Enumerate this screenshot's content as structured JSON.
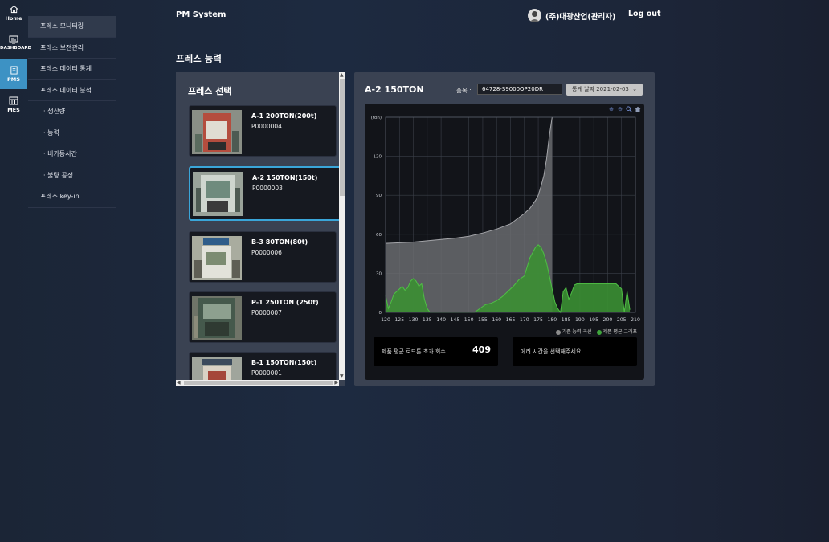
{
  "rail": {
    "home": "Home",
    "dashboard": "DASHBOARD",
    "pms": "PMS",
    "mes": "MES"
  },
  "sidebar": {
    "items": [
      {
        "label": "프레스 모니터링"
      },
      {
        "label": "프레스 보전관리"
      },
      {
        "label": "프레스 데이터 통계"
      },
      {
        "label": "프레스 데이터 분석"
      },
      {
        "label": "· 생산량"
      },
      {
        "label": "· 능력"
      },
      {
        "label": "· 비가동시간"
      },
      {
        "label": "· 불량 공정"
      },
      {
        "label": "프레스 key-in"
      }
    ]
  },
  "header": {
    "app_title": "PM System",
    "user": "(주)대광산업(관리자)",
    "logout": "Log out"
  },
  "page_title": "프레스 능력",
  "press_panel": {
    "title": "프레스 선택",
    "presses": [
      {
        "name": "A-1 200TON(200t)",
        "code": "P0000004"
      },
      {
        "name": "A-2 150TON(150t)",
        "code": "P0000003"
      },
      {
        "name": "B-3 80TON(80t)",
        "code": "P0000006"
      },
      {
        "name": "P-1 250TON (250t)",
        "code": "P0000007"
      },
      {
        "name": "B-1 150TON(150t)",
        "code": "P0000001"
      }
    ]
  },
  "chart_panel": {
    "title": "A-2 150TON",
    "product_label": "품목 :",
    "product_value": "64728-S9000OP20DR",
    "date_select": "통계 날짜 2021-02-03",
    "stat_label": "제품 평균 로드톤 초과 회수",
    "stat_value": "409",
    "message": "에러 시간을 선택해주세요.",
    "colors": {
      "capacity": "#8c8c8c",
      "product": "#3fa53c",
      "accent": "#3aa6d9"
    }
  },
  "chart_data": {
    "type": "area",
    "ylabel": "(ton)",
    "xlim": [
      120,
      210
    ],
    "ylim": [
      0,
      150
    ],
    "x_ticks": [
      "120",
      "125",
      "130",
      "135",
      "140",
      "145",
      "150",
      "155",
      "160",
      "165",
      "170",
      "175",
      "180",
      "185",
      "190",
      "195",
      "200",
      "205",
      "210"
    ],
    "y_ticks": [
      "0",
      "30",
      "60",
      "90",
      "120",
      "(ton)"
    ],
    "grid": true,
    "legend": "bottom-right",
    "series": [
      {
        "name": "기준 능력 곡선",
        "x": [
          120,
          125,
          130,
          135,
          140,
          145,
          150,
          155,
          160,
          165,
          170,
          172,
          174,
          175,
          176,
          177,
          178,
          179,
          180
        ],
        "values": [
          53,
          53.5,
          54,
          55,
          56,
          57,
          58.5,
          61,
          64,
          68,
          76,
          80,
          86,
          90,
          97,
          105,
          118,
          136,
          150
        ]
      },
      {
        "name": "제품 평균 그래프",
        "x": [
          120,
          121,
          122,
          123,
          124,
          125,
          126,
          127,
          128,
          129,
          130,
          131,
          132,
          133,
          134,
          135,
          136,
          137,
          138,
          139,
          140,
          141,
          142,
          143,
          144,
          145,
          146,
          147,
          148,
          149,
          150,
          152,
          154,
          156,
          158,
          160,
          162,
          164,
          166,
          168,
          170,
          171,
          172,
          173,
          174,
          175,
          176,
          177,
          178,
          179,
          180,
          181,
          182,
          183,
          184,
          185,
          186,
          187,
          188,
          189,
          190,
          192,
          194,
          196,
          198,
          200,
          202,
          203,
          204,
          205,
          206,
          207,
          208
        ],
        "values": [
          13,
          3,
          8,
          14,
          16,
          18,
          20,
          17,
          19,
          24,
          26,
          24,
          20,
          22,
          10,
          3,
          0,
          0,
          0,
          0,
          0,
          0,
          0,
          0,
          0,
          0,
          0,
          0,
          0,
          0,
          0,
          0,
          3,
          6,
          7,
          9,
          12,
          16,
          20,
          25,
          28,
          35,
          42,
          46,
          50,
          52,
          50,
          45,
          38,
          28,
          18,
          8,
          3,
          0,
          16,
          19,
          10,
          15,
          21,
          22,
          22,
          22,
          22,
          22,
          22,
          22,
          22,
          22,
          20,
          18,
          0,
          16,
          2
        ]
      }
    ]
  }
}
